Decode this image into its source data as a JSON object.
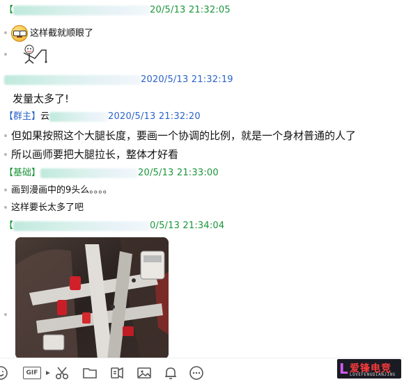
{
  "messages": [
    {
      "tag": "",
      "sender_redacted": true,
      "time": "20/5/13 21:32:05",
      "color": "green",
      "lines": [
        {
          "type": "emoji+text",
          "emoji": "cool-face-emoji",
          "text": "这样截就顺眼了"
        },
        {
          "type": "sticker",
          "emoji": "sticker-image"
        }
      ]
    },
    {
      "tag": "",
      "sender_redacted": true,
      "time": "2020/5/13 21:32:19",
      "color": "blue",
      "lines": [
        {
          "type": "text",
          "text": "发量太多了!"
        }
      ]
    },
    {
      "tag": "【群主】",
      "sender_visible": "云",
      "time": "2020/5/13 21:32:20",
      "color": "blue",
      "lines": [
        {
          "type": "text",
          "text": "但如果按照这个大腿长度，要画一个协调的比例，就是一个身材普通的人了"
        },
        {
          "type": "text",
          "text": "所以画师要把大腿拉长，整体才好看"
        }
      ]
    },
    {
      "tag": "【基础】",
      "sender_redacted": true,
      "time": "20/5/13 21:33:00",
      "color": "green",
      "lines": [
        {
          "type": "text",
          "text": "画到漫画中的9头么。。。。"
        },
        {
          "type": "text",
          "text": "这样要长太多了吧"
        }
      ]
    },
    {
      "tag": "【",
      "sender_redacted": true,
      "time": "0/5/13 21:34:04",
      "color": "green",
      "lines": [
        {
          "type": "image",
          "emoji": "anime-photo"
        }
      ]
    }
  ],
  "toolbar": {
    "gif_label": "GIF",
    "icons": [
      "emoji-icon",
      "gif-icon",
      "scissors-icon",
      "folder-icon",
      "voice-icon",
      "picture-icon",
      "bell-icon",
      "more-icon"
    ]
  },
  "watermark": {
    "text": "爱锋电竞",
    "sub": "LOVEFENGDIANJING",
    "logo_color": "#d35cf0"
  },
  "colors": {
    "green": "#19953a",
    "blue": "#2b63c9"
  }
}
